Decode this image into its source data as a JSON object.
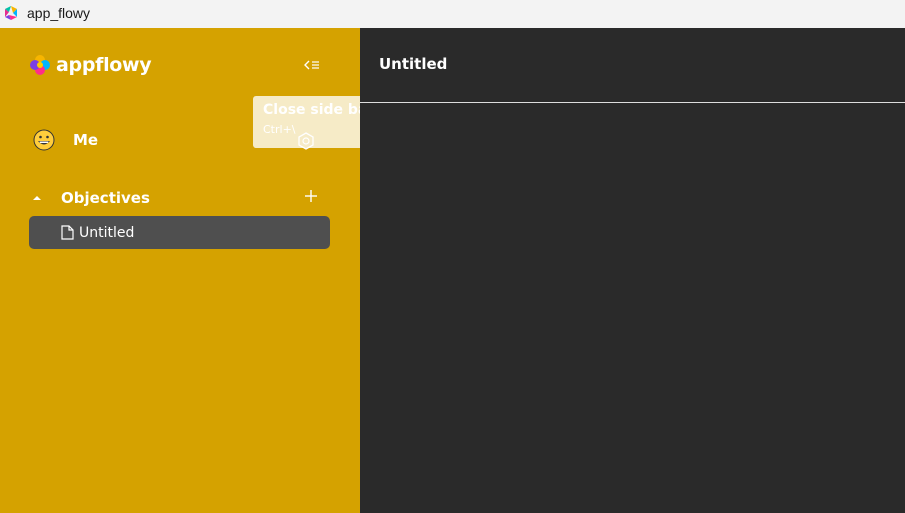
{
  "window": {
    "title": "app_flowy",
    "icon": "appflowy-logo-icon"
  },
  "sidebar": {
    "logo_text": "appflowy",
    "collapse_icon": "collapse-sidebar-icon",
    "tooltip": {
      "title": "Close side bar",
      "subtitle": "Ctrl+\\"
    },
    "user": {
      "name": "Me",
      "avatar": "grinning-emoji-icon"
    },
    "section": {
      "label": "Objectives",
      "expanded": true
    },
    "pages": [
      {
        "label": "Untitled",
        "icon": "document-icon",
        "selected": true
      }
    ]
  },
  "main": {
    "title": "Untitled"
  },
  "colors": {
    "sidebar_bg": "#d5a200",
    "main_bg": "#2a2a2a",
    "selected_bg": "#4f4f4f"
  }
}
